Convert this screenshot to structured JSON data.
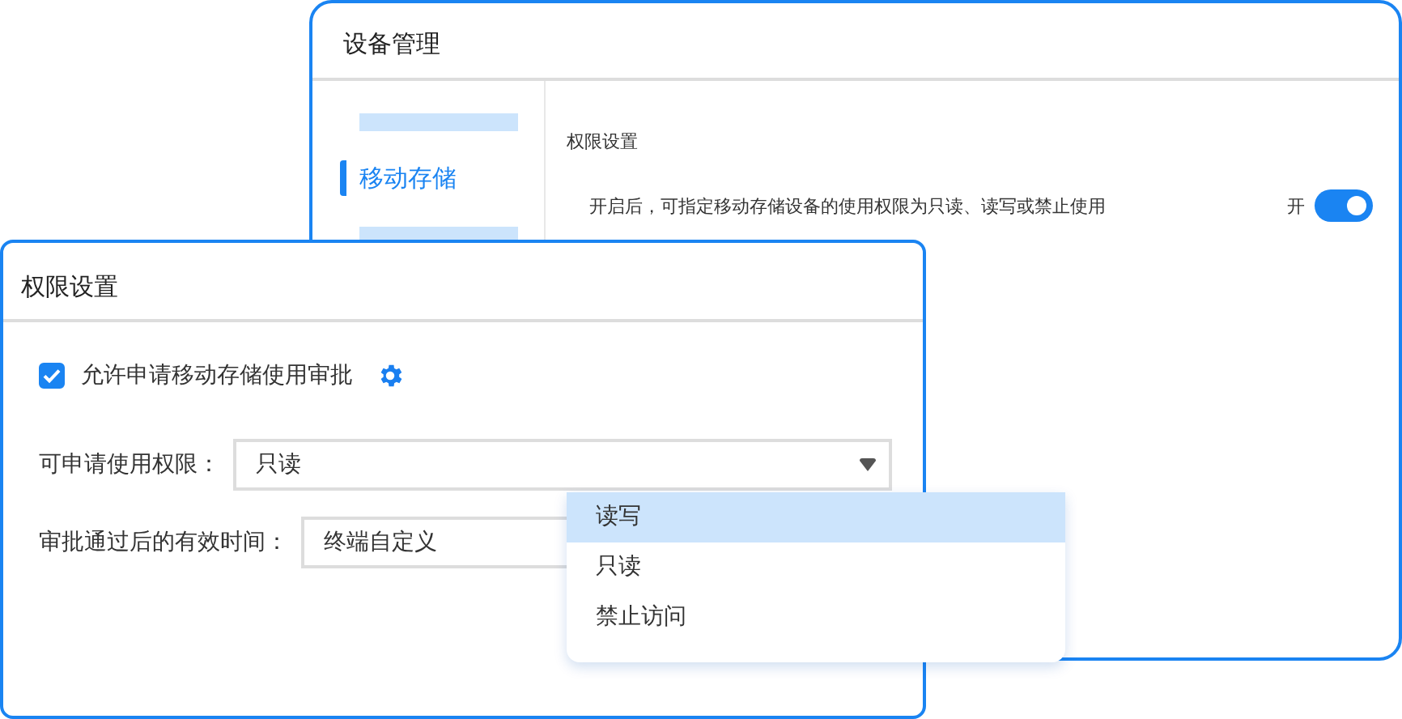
{
  "back_window": {
    "title": "设备管理",
    "sidebar": {
      "items": [
        {
          "label": "移动存储",
          "selected": true
        }
      ]
    },
    "section_title": "权限设置",
    "setting": {
      "description": "开启后，可指定移动存储设备的使用权限为只读、读写或禁止使用",
      "toggle_label": "开",
      "on": true
    }
  },
  "front_window": {
    "title": "权限设置",
    "checkbox": {
      "label": "允许申请移动存储使用审批",
      "checked": true
    },
    "fields": [
      {
        "label": "可申请使用权限：",
        "value": "只读"
      },
      {
        "label": "审批通过后的有效时间：",
        "value": "终端自定义"
      }
    ],
    "dropdown": {
      "options": [
        {
          "label": "读写",
          "highlighted": true
        },
        {
          "label": "只读",
          "highlighted": false
        },
        {
          "label": "禁止访问",
          "highlighted": false
        }
      ]
    }
  }
}
